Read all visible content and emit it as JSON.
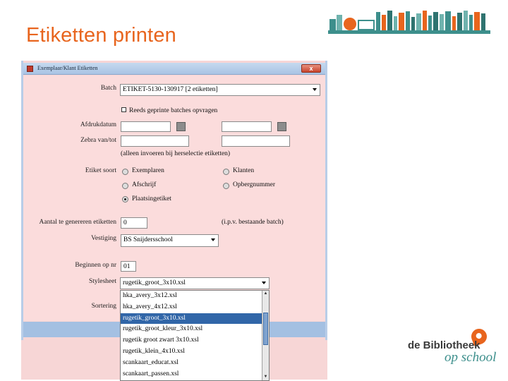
{
  "slide": {
    "title": "Etiketten printen"
  },
  "window": {
    "title": "Exemplaar/Klant Etiketten",
    "close_symbol": "x",
    "batch_label": "Batch",
    "batch_value": "ETIKET-5130-130917 [2 etiketten]",
    "reprint_checkbox_label": "Reeds geprinte batches opvragen",
    "print_date_label": "Afdrukdatum",
    "zebra_label": "Zebra van/tot",
    "zebra_note": "(alleen invoeren bij herselectie etiketten)",
    "label_type_label": "Etiket soort",
    "radio_options": {
      "exemplaren": "Exemplaren",
      "klanten": "Klanten",
      "afschrijf": "Afschrijf",
      "opbergnummer": "Opbergnummer",
      "plaatsingetiket": "Plaatsingetiket"
    },
    "count_label": "Aantal te genereren etiketten",
    "count_value": "0",
    "count_note": "(i.p.v. bestaande batch)",
    "branch_label": "Vestiging",
    "branch_value": "BS Snijdersschool",
    "start_label": "Beginnen op nr",
    "start_value": "01",
    "stylesheet_label": "Stylesheet",
    "stylesheet_value": "rugetik_groot_3x10.xsl",
    "sort_label": "Sortering",
    "stylesheet_options": [
      "hka_avery_3x12.xsl",
      "hka_avery_4x12.xsl",
      "rugetik_groot_3x10.xsl",
      "rugetik_groot_kleur_3x10.xsl",
      "rugetik groot zwart 3x10.xsl",
      "rugetik_klein_4x10.xsl",
      "scankaart_educat.xsl",
      "scankaart_passen.xsl"
    ],
    "selected_option_index": 2
  },
  "logo": {
    "line1": "de Bibliotheek",
    "line2": "op school"
  },
  "colors": {
    "accent": "#e8651e",
    "brand_teal": "#3d8f8c",
    "window_bg": "#fbdcdc",
    "selection": "#3166a8"
  }
}
